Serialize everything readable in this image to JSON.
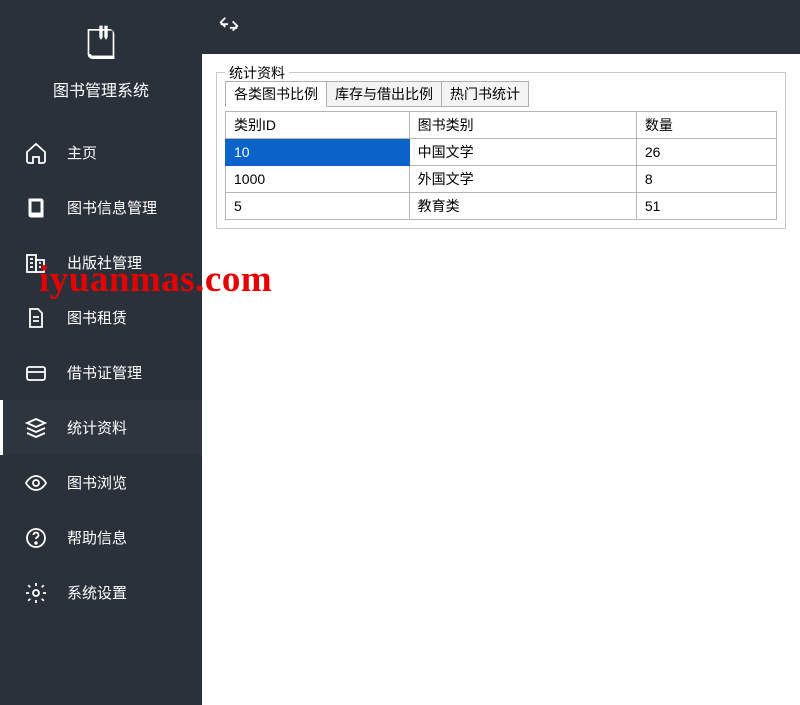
{
  "brand": {
    "title": "图书管理系统"
  },
  "sidebar": {
    "items": [
      {
        "label": "主页"
      },
      {
        "label": "图书信息管理"
      },
      {
        "label": "出版社管理"
      },
      {
        "label": "图书租赁"
      },
      {
        "label": "借书证管理"
      },
      {
        "label": "统计资料"
      },
      {
        "label": "图书浏览"
      },
      {
        "label": "帮助信息"
      },
      {
        "label": "系统设置"
      }
    ]
  },
  "panel": {
    "title": "统计资料",
    "tabs": [
      {
        "label": "各类图书比例"
      },
      {
        "label": "库存与借出比例"
      },
      {
        "label": "热门书统计"
      }
    ],
    "columns": [
      "类别ID",
      "图书类别",
      "数量"
    ],
    "rows": [
      {
        "id": "10",
        "category": "中国文学",
        "count": "26"
      },
      {
        "id": "1000",
        "category": "外国文学",
        "count": "8"
      },
      {
        "id": "5",
        "category": "教育类",
        "count": "51"
      }
    ]
  },
  "watermark": "iyuanmas.com"
}
